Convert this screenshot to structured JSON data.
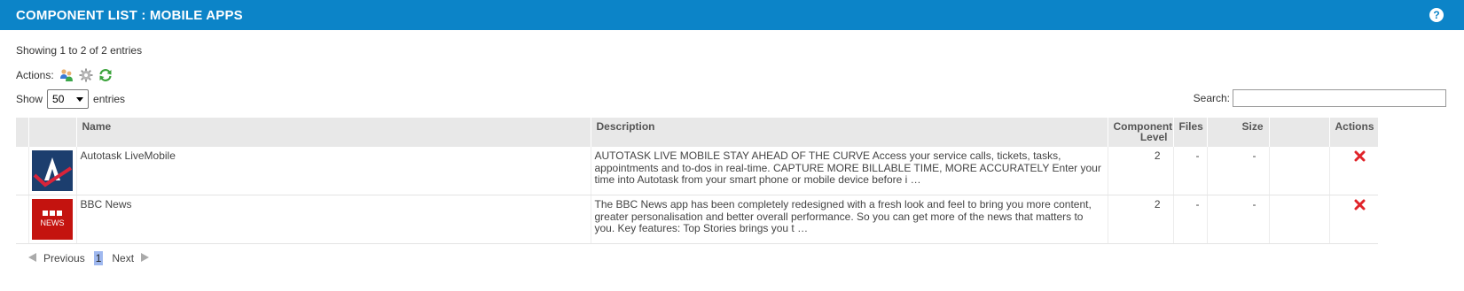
{
  "header": {
    "title": "COMPONENT LIST : MOBILE APPS",
    "help_icon": "?"
  },
  "info": {
    "showing": "Showing 1 to 2 of 2 entries"
  },
  "actions": {
    "label": "Actions:",
    "icons": [
      "users-icon",
      "gear-icon",
      "refresh-icon"
    ]
  },
  "length": {
    "show_label": "Show",
    "value": "50",
    "entries_label": "entries"
  },
  "search": {
    "label": "Search:",
    "value": ""
  },
  "table": {
    "columns": [
      "",
      "",
      "Name",
      "Description",
      "Component Level",
      "Files",
      "Size",
      "",
      "Actions"
    ],
    "rows": [
      {
        "logo": "autotask-logo",
        "name": "Autotask LiveMobile",
        "description": "AUTOTASK LIVE MOBILE STAY AHEAD OF THE CURVE Access your service calls, tickets, tasks, appointments and to-dos in real-time. CAPTURE MORE BILLABLE TIME, MORE ACCURATELY Enter your time into Autotask from your smart phone or mobile device before i …",
        "level": "2",
        "files": "-",
        "size": "-"
      },
      {
        "logo": "bbc-news-logo",
        "logo_text_1": "BBC",
        "logo_text_2": "NEWS",
        "name": "BBC News",
        "description": "The BBC News app has been completely redesigned with a fresh look and feel to bring you more content, greater personalisation and better overall performance. So you can get more of the news that matters to you. Key features: Top Stories brings you t …",
        "level": "2",
        "files": "-",
        "size": "-"
      }
    ]
  },
  "pagination": {
    "previous": "Previous",
    "current": "1",
    "next": "Next"
  },
  "colors": {
    "header": "#0c84c8",
    "delete": "#e0242a",
    "active_page": "#9fb8ef"
  }
}
